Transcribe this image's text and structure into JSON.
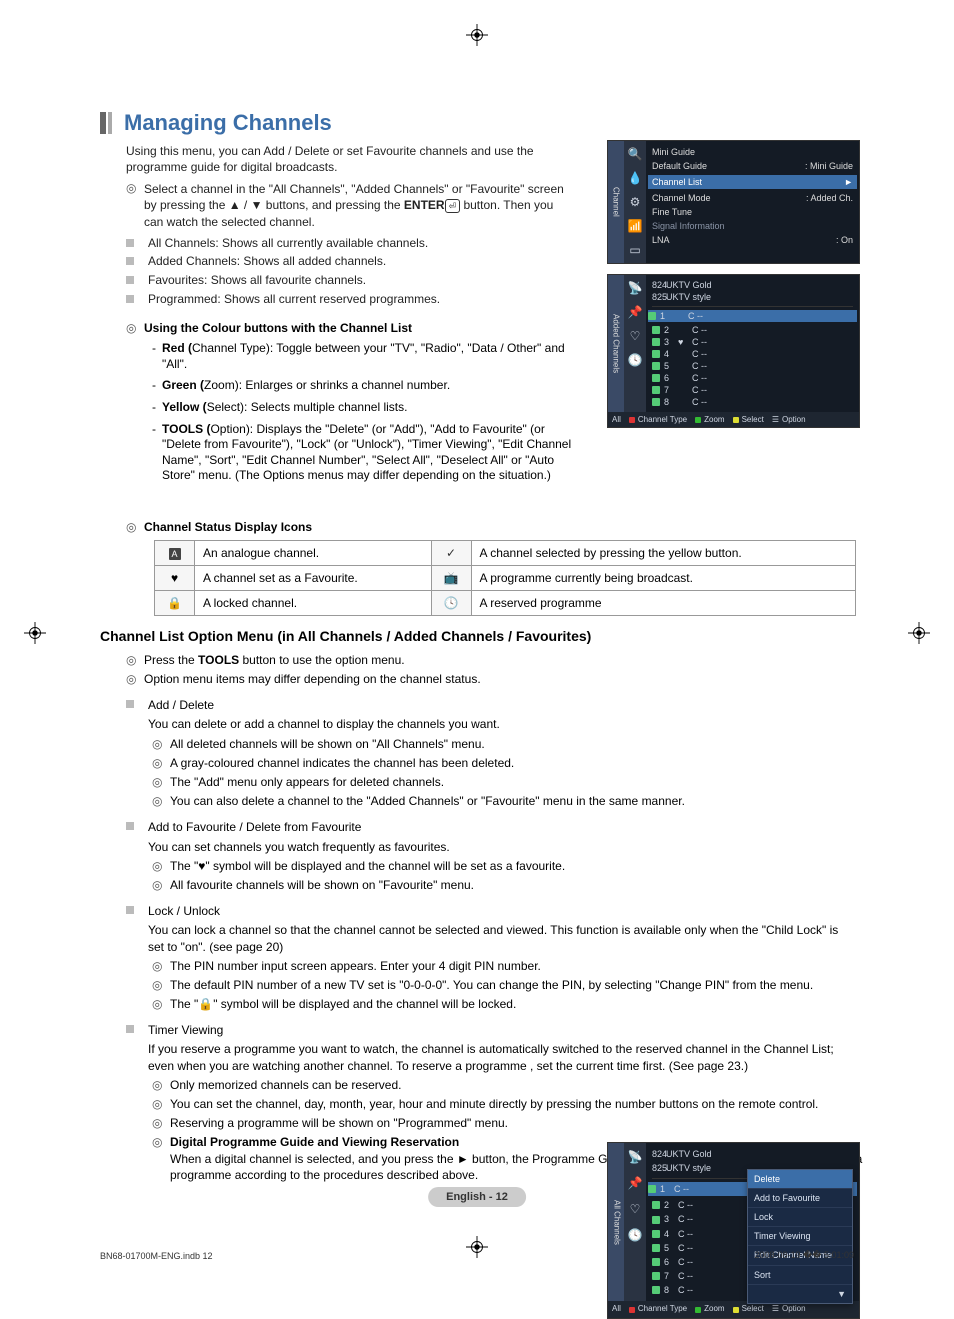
{
  "title": "Managing Channels",
  "intro": "Using this menu, you can Add / Delete or set Favourite channels and use the programme guide for digital broadcasts.",
  "mainNote": "Select a channel in the \"All Channels\", \"Added Channels\" or \"Favourite\" screen by pressing the ▲ / ▼ buttons, and pressing the ",
  "mainNoteEnter": "ENTER",
  "mainNoteTail": " button. Then you can watch the selected channel.",
  "bullets": [
    "All Channels: Shows all currently available channels.",
    "Added Channels: Shows all added channels.",
    "Favourites: Shows all favourite channels.",
    "Programmed: Shows all current reserved programmes."
  ],
  "colourHead": "Using the Colour buttons with the Channel List",
  "colourItems": [
    {
      "pre": "Red (",
      "mid": "Channel Type",
      "post": "): Toggle between your \"TV\", \"Radio\", \"Data / Other\" and \"All\"."
    },
    {
      "pre": "Green (",
      "mid": "Zoom",
      "post": "): Enlarges or shrinks a channel number."
    },
    {
      "pre": "Yellow (",
      "mid": "Select",
      "post": "): Selects multiple channel lists."
    },
    {
      "pre": "TOOLS (",
      "mid": "Option",
      "post": "): Displays the \"Delete\" (or \"Add\"), \"Add to Favourite\" (or \"Delete from Favourite\"), \"Lock\" (or \"Unlock\"), \"Timer Viewing\", \"Edit Channel Name\", \"Sort\", \"Edit Channel Number\", \"Select All\", \"Deselect All\" or \"Auto Store\" menu. (The Options menus may differ depending on the situation.)"
    }
  ],
  "statusHead": "Channel Status Display Icons",
  "statusRows": [
    {
      "iconL": "A",
      "textL": "An analogue channel.",
      "iconR": "✓",
      "textR": "A channel selected by pressing the yellow button."
    },
    {
      "iconL": "♥",
      "textL": "A channel set as a Favourite.",
      "iconR": "📺",
      "textR": "A programme currently being broadcast."
    },
    {
      "iconL": "🔒",
      "textL": "A locked channel.",
      "iconR": "🕓",
      "textR": "A reserved programme"
    }
  ],
  "subhead": "Channel List Option Menu (in All Channels / Added Channels / Favourites)",
  "optNotes": [
    "Press the TOOLS button to use the option menu.",
    "Option menu items may differ depending on the channel status."
  ],
  "optNoteBoldWord": "TOOLS",
  "blocks": [
    {
      "title": "Add / Delete",
      "desc": "You can delete or add a channel to display the channels you want.",
      "notes": [
        "All deleted channels will be shown on \"All Channels\" menu.",
        "A gray-coloured channel indicates the channel has been deleted.",
        "The \"Add\" menu only appears for deleted channels.",
        "You can also delete a channel to the \"Added Channels\" or \"Favourite\" menu in the same manner."
      ],
      "narrow": true
    },
    {
      "title": "Add to Favourite / Delete from Favourite",
      "desc": "You can set channels you watch frequently as favourites.",
      "notes": [
        "The \"♥\" symbol will be displayed and the channel will be set as a favourite.",
        "All favourite channels will be shown on \"Favourite\" menu."
      ],
      "narrow": true
    },
    {
      "title": "Lock / Unlock",
      "desc": "You can lock a channel so that the channel cannot be selected and viewed. This function is available only when the \"Child Lock\" is set to \"on\". (see page 20)",
      "notes": [
        "The PIN number input screen appears. Enter your 4 digit PIN number.",
        "The default PIN number of a new TV set is \"0-0-0-0\". You can change the PIN, by selecting \"Change PIN\" from the menu.",
        "The \"🔒\" symbol will be displayed and the channel will be locked."
      ],
      "narrow": false
    },
    {
      "title": "Timer Viewing",
      "desc": "If you reserve a programme you want to watch, the channel is automatically switched to the reserved channel in the Channel List; even when you are watching another channel. To reserve a programme , set the current time first. (See page 23.)",
      "notes": [
        "Only memorized channels can be reserved.",
        "You can set the channel, day, month, year, hour and minute directly by pressing the number buttons on the remote control.",
        "Reserving a programme will be shown on \"Programmed\" menu."
      ],
      "narrow": false,
      "tail": {
        "head": "Digital Programme Guide and Viewing Reservation",
        "body": "When a digital channel is selected, and you press the ► button, the Programme Guide for the channel appears. You can reserve a programme according to the procedures described above."
      }
    }
  ],
  "osd1": {
    "tab": "Channel",
    "miniGuide": "Mini Guide",
    "defaultGuide": "Default Guide",
    "defaultGuideVal": ": Mini Guide",
    "channelList": "Channel List",
    "channelMode": "Channel Mode",
    "channelModeVal": ": Added Ch.",
    "fineTune": "Fine Tune",
    "signalInfo": "Signal Information",
    "lna": "LNA",
    "lnaVal": ": On"
  },
  "osd1b": {
    "tab": "Added Channels",
    "top1": {
      "num": "824",
      "name": "UKTV Gold"
    },
    "top2": {
      "num": "825",
      "name": "UKTV style"
    },
    "rows": [
      {
        "num": "1",
        "name": "C --",
        "lock": ""
      },
      {
        "num": "2",
        "name": "C --",
        "lock": ""
      },
      {
        "num": "3",
        "name": "C --",
        "lock": "♥"
      },
      {
        "num": "4",
        "name": "C --",
        "lock": ""
      },
      {
        "num": "5",
        "name": "C --",
        "lock": ""
      },
      {
        "num": "6",
        "name": "C --",
        "lock": ""
      },
      {
        "num": "7",
        "name": "C --",
        "lock": ""
      },
      {
        "num": "8",
        "name": "C --",
        "lock": ""
      }
    ],
    "foot": {
      "all": "All",
      "ct": "Channel Type",
      "zoom": "Zoom",
      "sel": "Select",
      "opt": "Option"
    }
  },
  "osd2": {
    "tab": "All Channels",
    "top1": {
      "num": "824",
      "name": "UKTV Gold"
    },
    "top2": {
      "num": "825",
      "name": "UKTV style"
    },
    "rows": [
      {
        "num": "1",
        "name": "C --"
      },
      {
        "num": "2",
        "name": "C --"
      },
      {
        "num": "3",
        "name": "C --"
      },
      {
        "num": "4",
        "name": "C --"
      },
      {
        "num": "5",
        "name": "C --"
      },
      {
        "num": "6",
        "name": "C --"
      },
      {
        "num": "7",
        "name": "C --"
      },
      {
        "num": "8",
        "name": "C --"
      }
    ],
    "menu": [
      "Delete",
      "Add to Favourite",
      "Lock",
      "Timer Viewing",
      "Edit Channel Name",
      "Sort",
      "▼"
    ],
    "foot": {
      "all": "All",
      "ct": "Channel Type",
      "zoom": "Zoom",
      "sel": "Select",
      "opt": "Option"
    }
  },
  "pageBadge": "English - 12",
  "footerLeft": "BN68-01700M-ENG.indb   12",
  "footerRight": "2008-08-19   �� 5:01:09"
}
